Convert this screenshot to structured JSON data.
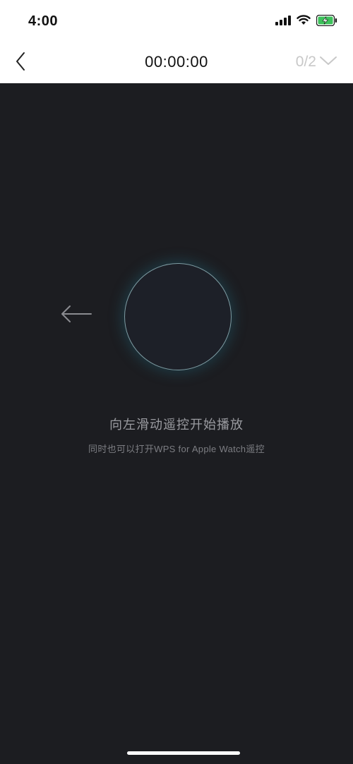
{
  "status_bar": {
    "time": "4:00",
    "icons": [
      "cellular-signal-icon",
      "wifi-icon",
      "battery-charging-icon"
    ]
  },
  "nav": {
    "back_icon": "chevron-left-icon",
    "timer": "00:00:00",
    "page_indicator": "0/2",
    "dropdown_icon": "chevron-down-icon"
  },
  "remote": {
    "swipe_arrow_icon": "arrow-left-icon",
    "instruction": "向左滑动遥控开始播放",
    "sub_instruction": "同时也可以打开WPS for Apple Watch遥控"
  },
  "colors": {
    "background": "#1c1d21",
    "header": "#ffffff",
    "circle_border": "#7e9ba2",
    "glow": "#226e80",
    "battery_green": "#3dc25b"
  }
}
